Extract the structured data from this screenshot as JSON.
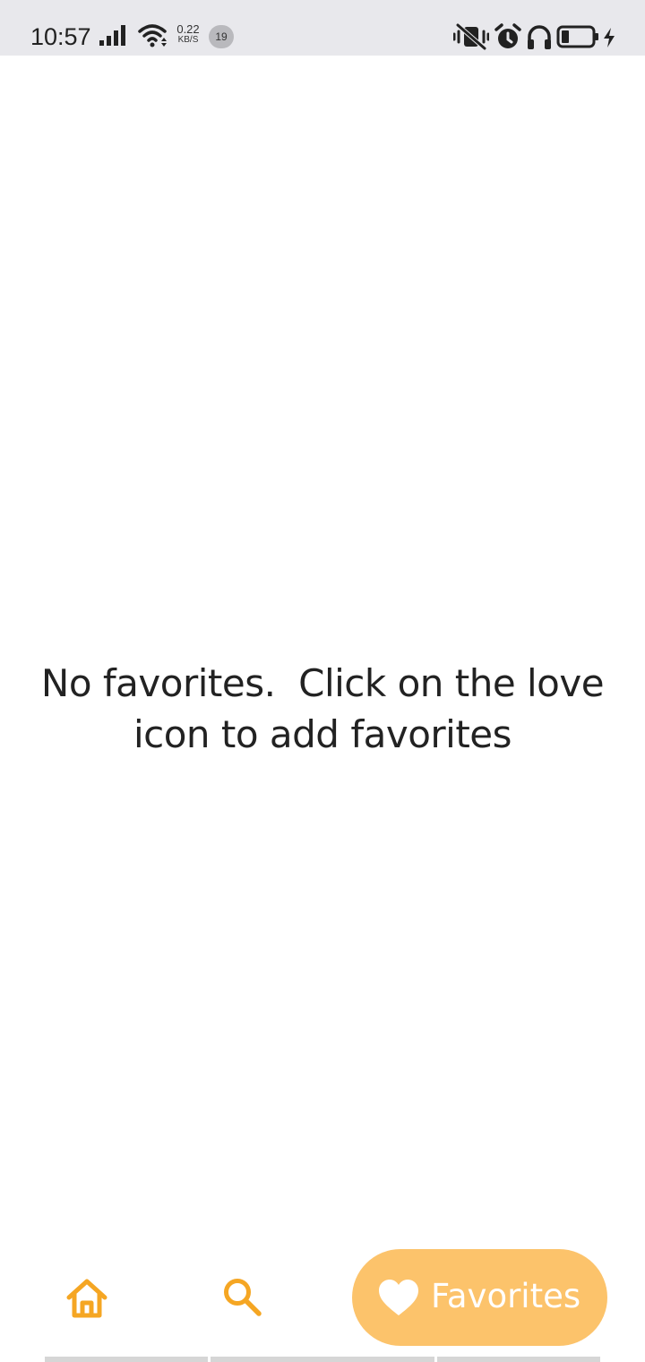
{
  "status_bar": {
    "time": "10:57",
    "net_speed_value": "0.22",
    "net_speed_unit": "KB/S",
    "notification_count": "19",
    "icons": [
      "signal-icon",
      "wifi-icon",
      "vibrate-icon",
      "alarm-icon",
      "headphones-icon",
      "battery-icon",
      "charging-icon"
    ]
  },
  "empty_state": {
    "line1": "No favorites.  Click on the love",
    "line2": "icon to add favorites"
  },
  "bottom_nav": {
    "items": [
      {
        "icon": "home-icon",
        "label": ""
      },
      {
        "icon": "search-icon",
        "label": ""
      },
      {
        "icon": "heart-icon",
        "label": "Favorites",
        "selected": true
      }
    ]
  },
  "colors": {
    "accent": "#f5a623",
    "selected_pill": "#fcc36b",
    "status_bar_bg": "#e8e8ec",
    "text": "#222222"
  }
}
